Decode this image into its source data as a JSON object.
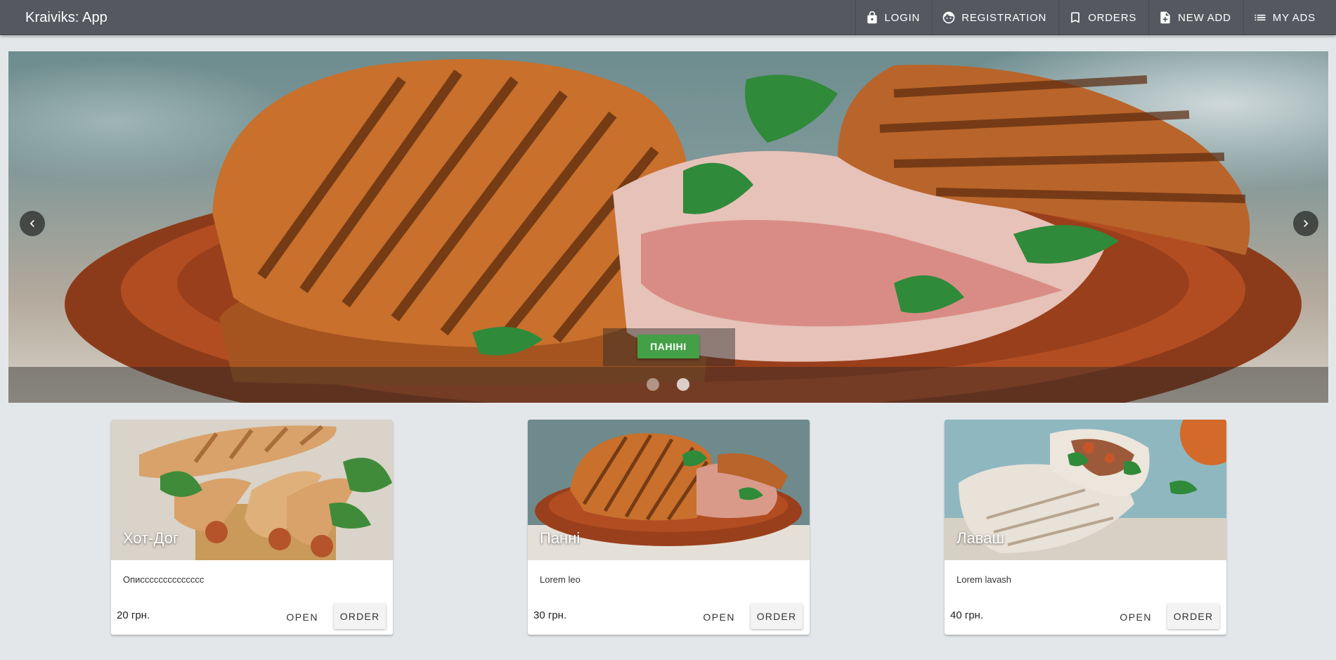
{
  "app": {
    "title": "Kraiviks: App"
  },
  "nav": {
    "items": [
      {
        "label": "LOGIN",
        "icon": "lock-icon"
      },
      {
        "label": "REGISTRATION",
        "icon": "face-icon"
      },
      {
        "label": "ORDERS",
        "icon": "bookmark-icon"
      },
      {
        "label": "NEW ADD",
        "icon": "note-add-icon"
      },
      {
        "label": "MY ADS",
        "icon": "list-icon"
      }
    ]
  },
  "carousel": {
    "caption": "ПАНІНІ",
    "slides_count": 2,
    "active_slide": 2,
    "prev_icon": "chevron-left-icon",
    "next_icon": "chevron-right-icon"
  },
  "cards": [
    {
      "title": "Хот-Дог",
      "description": "Описссссссссссссс",
      "price": "20 грн.",
      "open_label": "OPEN",
      "order_label": "ORDER"
    },
    {
      "title": "Панні",
      "description": "Lorem leo",
      "price": "30 грн.",
      "open_label": "OPEN",
      "order_label": "ORDER"
    },
    {
      "title": "Лаваш",
      "description": "Lorem lavash",
      "price": "40 грн.",
      "open_label": "OPEN",
      "order_label": "ORDER"
    }
  ],
  "colors": {
    "appbar": "#55595f",
    "page_background": "#e4e7ea",
    "caption_button": "#43a047"
  }
}
